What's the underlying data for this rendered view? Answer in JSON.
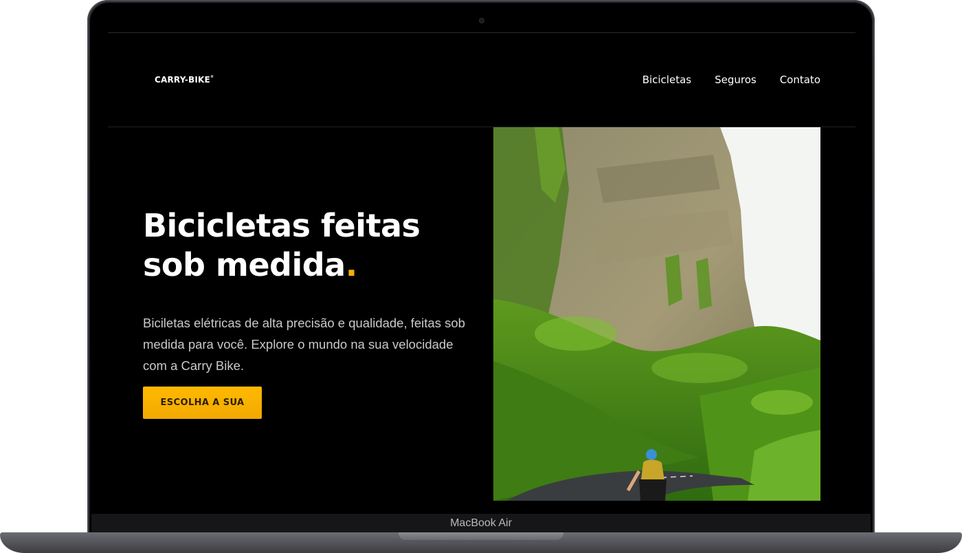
{
  "device": {
    "label": "MacBook Air"
  },
  "site": {
    "logo": "CARRY-BIKE",
    "logo_mark": "®",
    "nav": [
      "Bicicletas",
      "Seguros",
      "Contato"
    ],
    "hero": {
      "title_line1": "Bicicletas feitas",
      "title_line2": "sob medida",
      "title_dot": ".",
      "description": "Biciletas elétricas de alta precisão e qualidade, feitas sob medida para você. Explore o mundo na sua velocidade com a Carry Bike.",
      "cta": "ESCOLHA A SUA"
    }
  },
  "colors": {
    "accent": "#f5b000",
    "background": "#000000",
    "text": "#ffffff"
  }
}
